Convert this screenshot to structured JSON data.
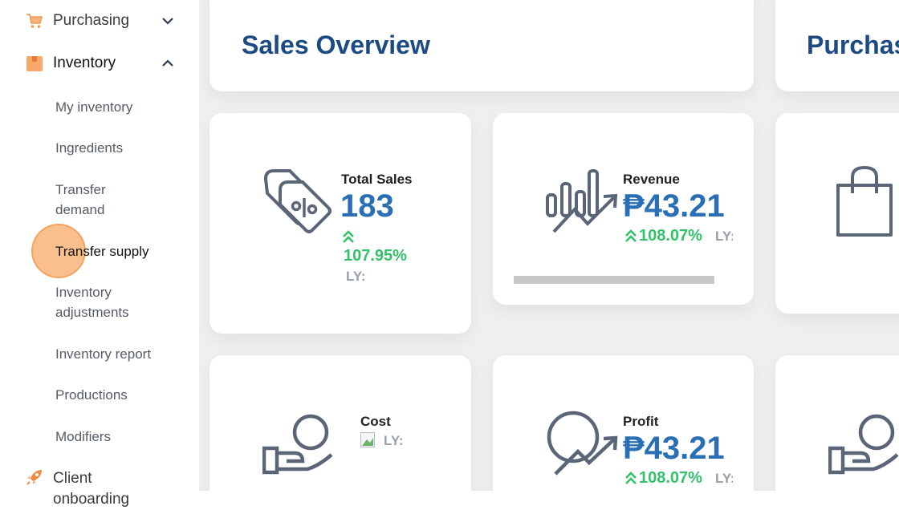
{
  "sidebar": {
    "purchasing": {
      "label": "Purchasing",
      "icon": "cart-icon"
    },
    "inventory": {
      "label": "Inventory",
      "icon": "box-icon"
    },
    "sub_items": [
      "My inventory",
      "Ingredients",
      "Transfer demand",
      "Transfer supply",
      "Inventory adjustments",
      "Inventory report",
      "Productions",
      "Modifiers"
    ],
    "client_onboarding": {
      "label": "Client onboarding",
      "icon": "rocket-icon"
    }
  },
  "main": {
    "sales_overview_title": "Sales Overview",
    "purchase_title_partial": "Purchas",
    "total_sales": {
      "label": "Total Sales",
      "value": "183",
      "change": "107.95%",
      "ly": "LY:"
    },
    "revenue": {
      "label": "Revenue",
      "value": "₱43.21",
      "change": "108.07%",
      "ly": "LY:"
    },
    "cost": {
      "label": "Cost",
      "ly": "LY:"
    },
    "profit": {
      "label": "Profit",
      "value": "₱43.21",
      "change": "108.07%",
      "ly": "LY:"
    }
  },
  "colors": {
    "accent_orange": "#f5a060",
    "title_blue": "#1c4a82",
    "value_blue": "#2a6fb5",
    "positive_green": "#35c06a",
    "icon_gray": "#5a6578"
  }
}
